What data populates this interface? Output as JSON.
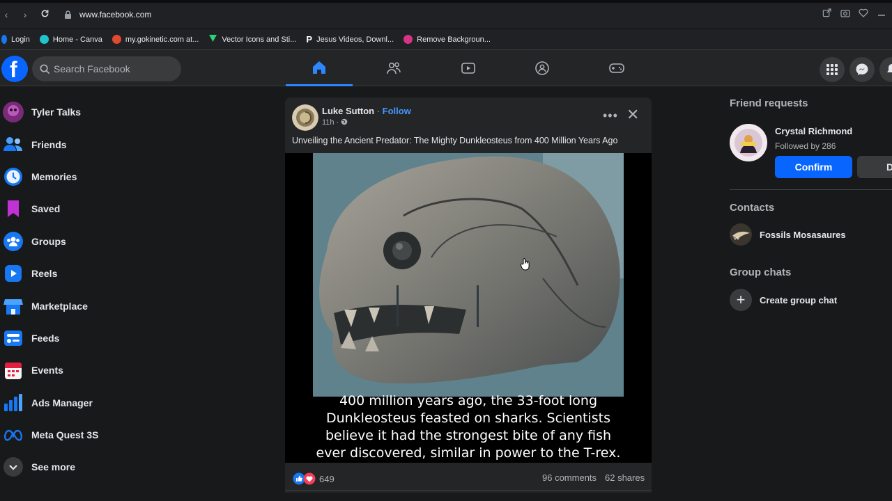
{
  "browser": {
    "url": "www.facebook.com",
    "bookmarks": [
      {
        "label": "Login",
        "color": "#1877f2"
      },
      {
        "label": "Home - Canva",
        "color": "#20c4cb"
      },
      {
        "label": "my.gokinetic.com at...",
        "color": "#e04a2f"
      },
      {
        "label": "Vector Icons and Sti...",
        "color": "#2bd27a"
      },
      {
        "label": "Jesus Videos, Downl...",
        "color": "#ffffff"
      },
      {
        "label": "Remove Backgroun...",
        "color": "#d63384"
      }
    ]
  },
  "header": {
    "logo": "f",
    "search_placeholder": "Search Facebook",
    "tabs": [
      "home-icon",
      "friends-icon",
      "video-icon",
      "groups-icon",
      "gaming-icon"
    ],
    "active_tab": "home-icon",
    "accent": "#2d88ff"
  },
  "sidebar": {
    "items": [
      {
        "label": "Tyler Talks",
        "icon": "profile-avatar-icon"
      },
      {
        "label": "Friends",
        "icon": "friends-icon"
      },
      {
        "label": "Memories",
        "icon": "clock-icon"
      },
      {
        "label": "Saved",
        "icon": "bookmark-icon"
      },
      {
        "label": "Groups",
        "icon": "groups-icon"
      },
      {
        "label": "Reels",
        "icon": "reels-icon"
      },
      {
        "label": "Marketplace",
        "icon": "shop-icon"
      },
      {
        "label": "Feeds",
        "icon": "feeds-icon"
      },
      {
        "label": "Events",
        "icon": "calendar-icon"
      },
      {
        "label": "Ads Manager",
        "icon": "bar-chart-icon"
      },
      {
        "label": "Meta Quest 3S",
        "icon": "meta-icon"
      },
      {
        "label": "See more",
        "icon": "chevron-down-icon"
      }
    ]
  },
  "post": {
    "author": "Luke Sutton",
    "separator": " · ",
    "follow": "Follow",
    "time": "11h · ",
    "caption": "Unveiling the Ancient Predator: The Mighty Dunkleosteus from 400 Million Years Ago",
    "image_text": [
      "400 million years ago, the 33-foot long",
      "Dunkleosteus feasted on sharks. Scientists",
      "believe it had the strongest bite of any fish",
      "ever discovered, similar in power to the T-rex."
    ],
    "reaction_count": "649",
    "comments": "96 comments",
    "shares": "62 shares"
  },
  "right": {
    "friend_requests_title": "Friend requests",
    "request": {
      "name": "Crystal Richmond",
      "mutual": "Followed by 286",
      "confirm": "Confirm",
      "delete": "Delete"
    },
    "contacts_title": "Contacts",
    "contacts": [
      {
        "name": "Fossils Mosasaures"
      }
    ],
    "group_chats_title": "Group chats",
    "create_group": "Create group chat"
  }
}
